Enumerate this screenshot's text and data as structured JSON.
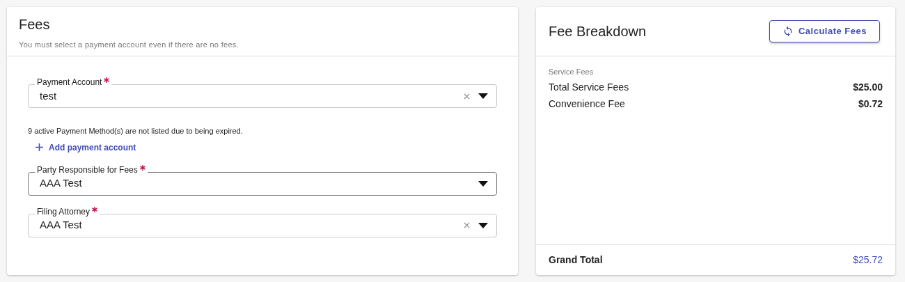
{
  "fees_card": {
    "title": "Fees",
    "subtitle": "You must select a payment account even if there are no fees.",
    "fields": [
      {
        "label": "Payment Account",
        "required": true,
        "value": "test",
        "clearable": true,
        "focused": false,
        "note": "9 active Payment Method(s) are not listed due to being expired.",
        "link": "Add payment account"
      },
      {
        "label": "Party Responsible for Fees",
        "required": true,
        "value": "AAA Test",
        "clearable": false,
        "focused": true
      },
      {
        "label": "Filing Attorney",
        "required": true,
        "value": "AAA Test",
        "clearable": true,
        "focused": false
      }
    ]
  },
  "breakdown_card": {
    "title": "Fee Breakdown",
    "button": "Calculate Fees",
    "section": "Service Fees",
    "rows": [
      {
        "label": "Total Service Fees",
        "amount": "$25.00"
      },
      {
        "label": "Convenience Fee",
        "amount": "$0.72"
      }
    ],
    "total": {
      "label": "Grand Total",
      "amount": "$25.72"
    }
  }
}
